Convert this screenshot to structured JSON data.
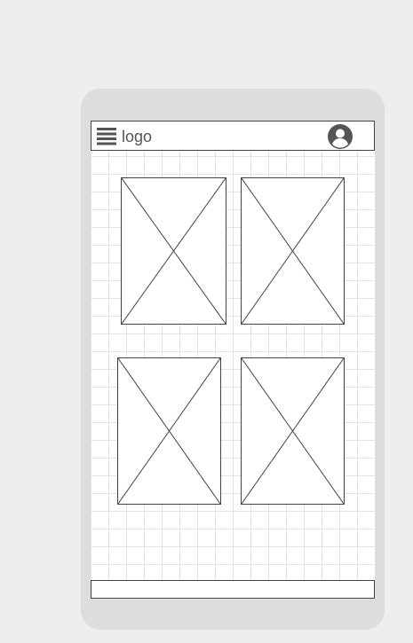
{
  "header": {
    "logo_text": "logo",
    "menu_icon": "hamburger-menu-icon",
    "profile_icon": "user-avatar-icon"
  },
  "content": {
    "image_placeholders": [
      {
        "name": "image-placeholder-1",
        "icon": "image-placeholder-x"
      },
      {
        "name": "image-placeholder-2",
        "icon": "image-placeholder-x"
      },
      {
        "name": "image-placeholder-3",
        "icon": "image-placeholder-x"
      },
      {
        "name": "image-placeholder-4",
        "icon": "image-placeholder-x"
      }
    ]
  },
  "footer": {
    "text": ""
  },
  "colors": {
    "page_background": "#eeeeee",
    "device_frame": "#dddddd",
    "screen_background": "#ffffff",
    "grid_line": "#e3e3e3",
    "outline": "#444444",
    "icon": "#555555"
  }
}
